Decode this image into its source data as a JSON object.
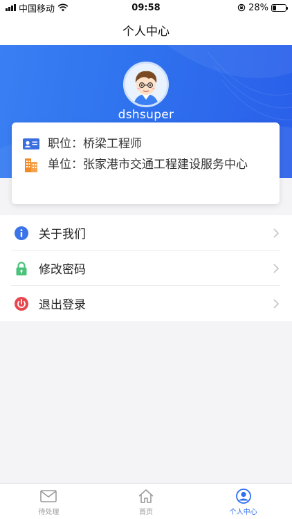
{
  "status_bar": {
    "carrier": "中国移动",
    "time": "09:58",
    "battery": "28%",
    "battery_level": 0.28
  },
  "nav": {
    "title": "个人中心"
  },
  "profile": {
    "username": "dshsuper"
  },
  "info_card": {
    "position_label": "职位：桥梁工程师",
    "unit_label": "单位：张家港市交通工程建设服务中心"
  },
  "menu": {
    "items": [
      {
        "label": "关于我们",
        "icon": "info-icon"
      },
      {
        "label": "修改密码",
        "icon": "lock-icon"
      },
      {
        "label": "退出登录",
        "icon": "power-icon"
      }
    ]
  },
  "tabs": [
    {
      "label": "待处理",
      "icon": "mail-icon",
      "active": false
    },
    {
      "label": "首页",
      "icon": "home-icon",
      "active": false
    },
    {
      "label": "个人中心",
      "icon": "user-icon",
      "active": true
    }
  ],
  "colors": {
    "primary": "#2f6ff0",
    "tab_inactive": "#9a9a9a",
    "lock": "#4cc27a",
    "power": "#e8474f",
    "info": "#3b74e8",
    "building": "#f08a24"
  }
}
